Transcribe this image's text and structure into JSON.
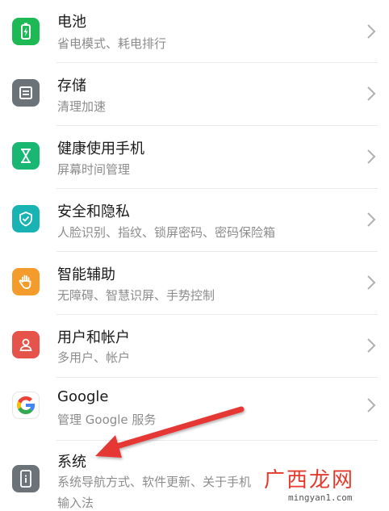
{
  "settings": {
    "items": [
      {
        "title": "电池",
        "subtitle": "省电模式、耗电排行",
        "icon": "battery-icon",
        "color": "#1db954"
      },
      {
        "title": "存储",
        "subtitle": "清理加速",
        "icon": "storage-icon",
        "color": "#6b7378"
      },
      {
        "title": "健康使用手机",
        "subtitle": "屏幕时间管理",
        "icon": "hourglass-icon",
        "color": "#19b772"
      },
      {
        "title": "安全和隐私",
        "subtitle": "人脸识别、指纹、锁屏密码、密码保险箱",
        "icon": "shield-icon",
        "color": "#19b3b3"
      },
      {
        "title": "智能辅助",
        "subtitle": "无障碍、智慧识屏、手势控制",
        "icon": "hand-icon",
        "color": "#f39c2b"
      },
      {
        "title": "用户和帐户",
        "subtitle": "多用户、帐户",
        "icon": "user-icon",
        "color": "#e5534b"
      },
      {
        "title": "Google",
        "subtitle": "管理 Google 服务",
        "icon": "google-icon",
        "color": "#4285f4"
      },
      {
        "title": "系统",
        "subtitle": "系统导航方式、软件更新、关于手机",
        "icon": "phone-info-icon",
        "color": "#6b7378"
      }
    ],
    "overflow_text": "输入法"
  },
  "annotation": {
    "arrow_color": "#e53935"
  },
  "watermark": {
    "logo_text": "广西龙网",
    "url": "mingyan1.com"
  }
}
